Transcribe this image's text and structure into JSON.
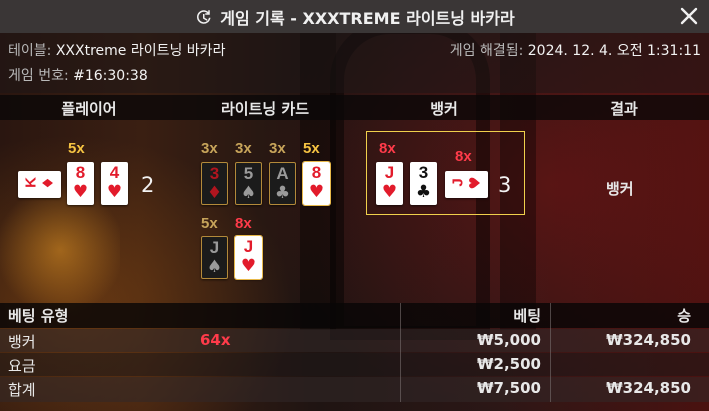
{
  "header": {
    "title": "게임 기록 - XXXTREME 라이트닝 바카라"
  },
  "info": {
    "table_label": "테이블:",
    "table_value": "XXXtreme 라이트닝 바카라",
    "settled_label": "게임 해결됨:",
    "settled_value": "2024. 12. 4. 오전 1:31:11",
    "game_no_label": "게임 번호:",
    "game_no_value": "#16:30:38"
  },
  "columns": {
    "player": "플레이어",
    "lightning": "라이트닝 카드",
    "banker": "뱅커",
    "result": "결과"
  },
  "player": {
    "score": "2",
    "cards": [
      {
        "rank": "K",
        "suit": "♦",
        "color": "red",
        "orientation": "sideways"
      },
      {
        "rank": "8",
        "suit": "♥",
        "color": "red",
        "orientation": "upright",
        "multiplier": "5x"
      },
      {
        "rank": "4",
        "suit": "♥",
        "color": "red",
        "orientation": "upright"
      }
    ]
  },
  "lightning_cards": [
    {
      "rank": "3",
      "suit": "♦",
      "color": "red",
      "multiplier": "3x",
      "active": false
    },
    {
      "rank": "5",
      "suit": "♠",
      "color": "black",
      "multiplier": "3x",
      "active": false
    },
    {
      "rank": "A",
      "suit": "♣",
      "color": "black",
      "multiplier": "3x",
      "active": false
    },
    {
      "rank": "8",
      "suit": "♥",
      "color": "red",
      "multiplier": "5x",
      "active": true
    },
    {
      "rank": "J",
      "suit": "♠",
      "color": "black",
      "multiplier": "5x",
      "active": false
    },
    {
      "rank": "J",
      "suit": "♥",
      "color": "red",
      "multiplier": "8x",
      "active": true
    }
  ],
  "banker": {
    "score": "3",
    "cards": [
      {
        "rank": "J",
        "suit": "♥",
        "color": "red",
        "orientation": "upright",
        "multiplier": "8x"
      },
      {
        "rank": "3",
        "suit": "♣",
        "color": "black",
        "orientation": "upright"
      },
      {
        "rank": "J",
        "suit": "♥",
        "color": "red",
        "orientation": "sideways",
        "multiplier": "8x"
      }
    ]
  },
  "result": "뱅커",
  "bets": {
    "headers": {
      "type": "베팅 유형",
      "bet": "베팅",
      "win": "승"
    },
    "rows": [
      {
        "type": "뱅커",
        "multiplier": "64x",
        "bet": "₩5,000",
        "win": "₩324,850"
      },
      {
        "type": "요금",
        "multiplier": "",
        "bet": "₩2,500",
        "win": ""
      },
      {
        "type": "합계",
        "multiplier": "",
        "bet": "₩7,500",
        "win": "₩324,850"
      }
    ]
  },
  "colors": {
    "title_bar": "#3a3636",
    "gold": "#f5c342",
    "red_multiplier": "#ff3b4a",
    "card_red": "#e21b2b",
    "banker_highlight": "#f0d04c"
  },
  "icons": {
    "title": "history-icon",
    "close": "close-icon"
  }
}
